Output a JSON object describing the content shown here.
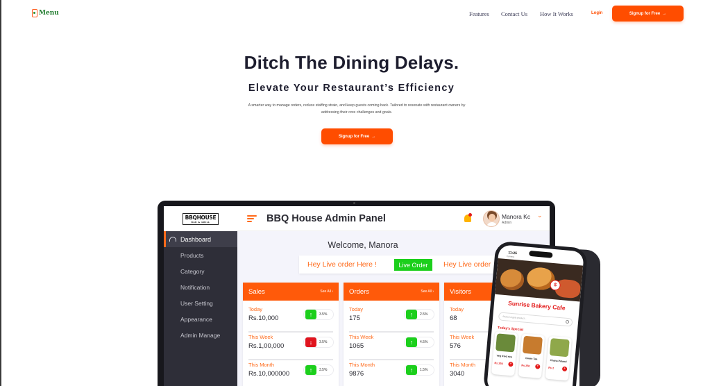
{
  "brand": {
    "logo_text": "Menu",
    "accent": "#ff4d00"
  },
  "nav": {
    "features": "Features",
    "contact": "Contact Us",
    "how": "How It Works",
    "login": "Login",
    "signup": "Signup for Free",
    "arrow": "→"
  },
  "hero": {
    "title": "Ditch The Dining Delays.",
    "subtitle": "Elevate Your Restaurant’s Efficiency",
    "description": "A smarter way to manage orders, reduce staffing strain, and keep guests coming back. Tailored to resonate with restaurant owners by addressing their core challenges and goals.",
    "cta": "Signup for Free"
  },
  "admin": {
    "logo_main": "BBQHOUSE",
    "logo_sub": "BAR & GRILL",
    "title": "BBQ House Admin Panel",
    "user_name": "Manora Kc",
    "user_role": "Admin",
    "sidebar": [
      "Dashboard",
      "Products",
      "Category",
      "Notification",
      "User Setting",
      "Appearance",
      "Admin Manage"
    ],
    "welcome": "Welcome, Manora",
    "live_left": "Hey Live order Here !",
    "live_button": "Live Order",
    "live_right": "Hey Live order",
    "see_all": "See All",
    "cards": [
      {
        "title": "Sales",
        "rows": [
          {
            "label": "Today",
            "value": "Rs.10,000",
            "change": "3.5%",
            "dir": "up"
          },
          {
            "label": "This Week",
            "value": "Rs.1,00,000",
            "change": "3.5%",
            "dir": "down"
          },
          {
            "label": "This Month",
            "value": "Rs.10,000000",
            "change": "3.5%",
            "dir": "up"
          }
        ]
      },
      {
        "title": "Orders",
        "rows": [
          {
            "label": "Today",
            "value": "175",
            "change": "2.5%",
            "dir": "up"
          },
          {
            "label": "This Week",
            "value": "1065",
            "change": "4.5%",
            "dir": "up"
          },
          {
            "label": "This Month",
            "value": "9876",
            "change": "1.5%",
            "dir": "up"
          }
        ]
      },
      {
        "title": "Visitors",
        "rows": [
          {
            "label": "Today",
            "value": "68"
          },
          {
            "label": "This Week",
            "value": "576"
          },
          {
            "label": "This Month",
            "value": "3040"
          }
        ]
      }
    ]
  },
  "phone": {
    "time": "11:25",
    "carrier": "Camera",
    "cafe_name": "Sunrise Bakery Cafe",
    "search_placeholder": "Search & gets product...",
    "special_label": "Today's Special",
    "items": [
      {
        "name": "Veg fried rice",
        "price": "Rs 250"
      },
      {
        "name": "Green Tea",
        "price": "Rs 250"
      },
      {
        "name": "Chana Pulaod",
        "price": "Rs 2"
      }
    ]
  }
}
